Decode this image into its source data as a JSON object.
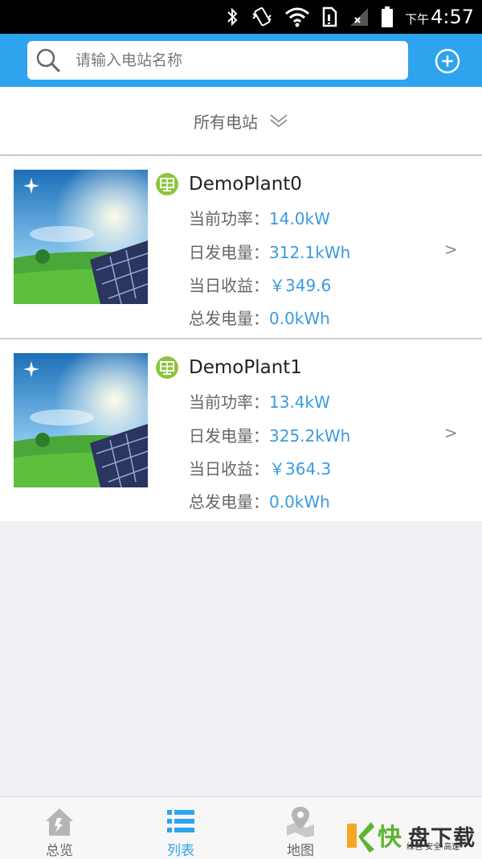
{
  "status_bar": {
    "time_prefix": "下午",
    "time": "4:57",
    "icons": [
      "bluetooth-icon",
      "vibrate-icon",
      "wifi-icon",
      "sim-icon",
      "signal-icon",
      "battery-icon"
    ]
  },
  "search": {
    "placeholder": "请输入电站名称",
    "value": ""
  },
  "colors": {
    "accent": "#2ea3ee",
    "value_text": "#3a9be0",
    "badge_green": "#8cc63f"
  },
  "filter": {
    "label": "所有电站"
  },
  "plants": [
    {
      "name": "DemoPlant0",
      "power_label": "当前功率：",
      "power": "14.0kW",
      "daily_label": "日发电量：",
      "daily": "312.1kWh",
      "income_label": "当日收益：",
      "income": "￥349.6",
      "total_label": "总发电量：",
      "total": "0.0kWh",
      "arrow": ">"
    },
    {
      "name": "DemoPlant1",
      "power_label": "当前功率：",
      "power": "13.4kW",
      "daily_label": "日发电量：",
      "daily": "325.2kWh",
      "income_label": "当日收益：",
      "income": "￥364.3",
      "total_label": "总发电量：",
      "total": "0.0kWh",
      "arrow": ">"
    }
  ],
  "nav": [
    {
      "label": "总览",
      "icon": "home-icon"
    },
    {
      "label": "列表",
      "icon": "list-icon"
    },
    {
      "label": "地图",
      "icon": "map-pin-icon"
    }
  ],
  "watermark": {
    "main": "快",
    "title": "盘下载",
    "sub": "绿色·安全·高速"
  }
}
